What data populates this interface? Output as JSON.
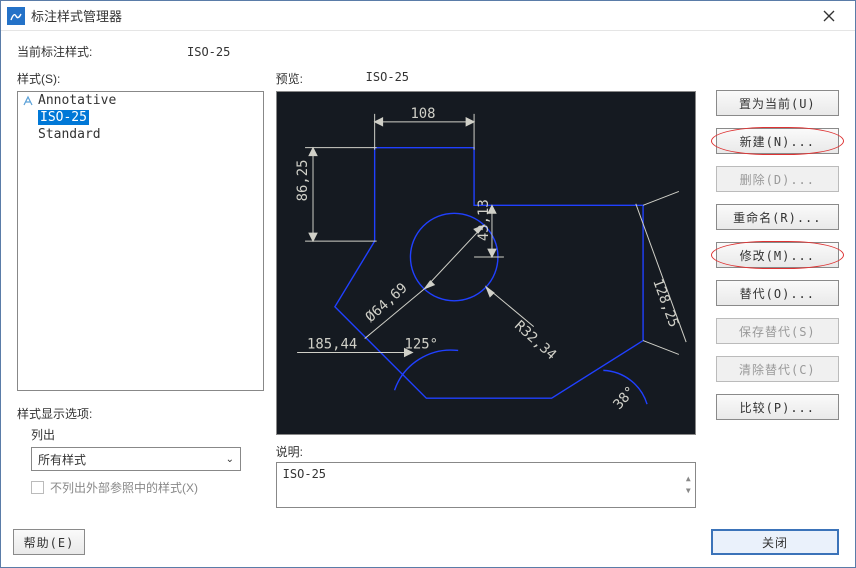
{
  "window": {
    "title": "标注样式管理器"
  },
  "current_style_label": "当前标注样式:",
  "current_style_value": "ISO-25",
  "styles_label": "样式(S):",
  "styles": {
    "items": [
      "Annotative",
      "ISO-25",
      "Standard"
    ],
    "selected_index": 1
  },
  "display_options": {
    "title": "样式显示选项:",
    "list_label": "列出",
    "dropdown_value": "所有样式",
    "checkbox_label": "不列出外部参照中的样式(X)",
    "checkbox_checked": false
  },
  "preview": {
    "label": "预览:",
    "value": "ISO-25",
    "dims": {
      "top": "108",
      "left": "86,25",
      "circ_d": "Ø64,69",
      "circ_r": "R32,34",
      "vert_short": "43,13",
      "diag_right": "128,25",
      "angle": "125°",
      "baseline": "185,44",
      "ang_right": "38°"
    }
  },
  "description": {
    "label": "说明:",
    "text": "ISO-25"
  },
  "buttons": {
    "set_current": "置为当前(U)",
    "new": "新建(N)...",
    "delete": "删除(D)...",
    "rename": "重命名(R)...",
    "modify": "修改(M)...",
    "override": "替代(O)...",
    "save_override": "保存替代(S)",
    "clear_override": "清除替代(C)",
    "compare": "比较(P)...",
    "help": "帮助(E)",
    "close": "关闭"
  }
}
